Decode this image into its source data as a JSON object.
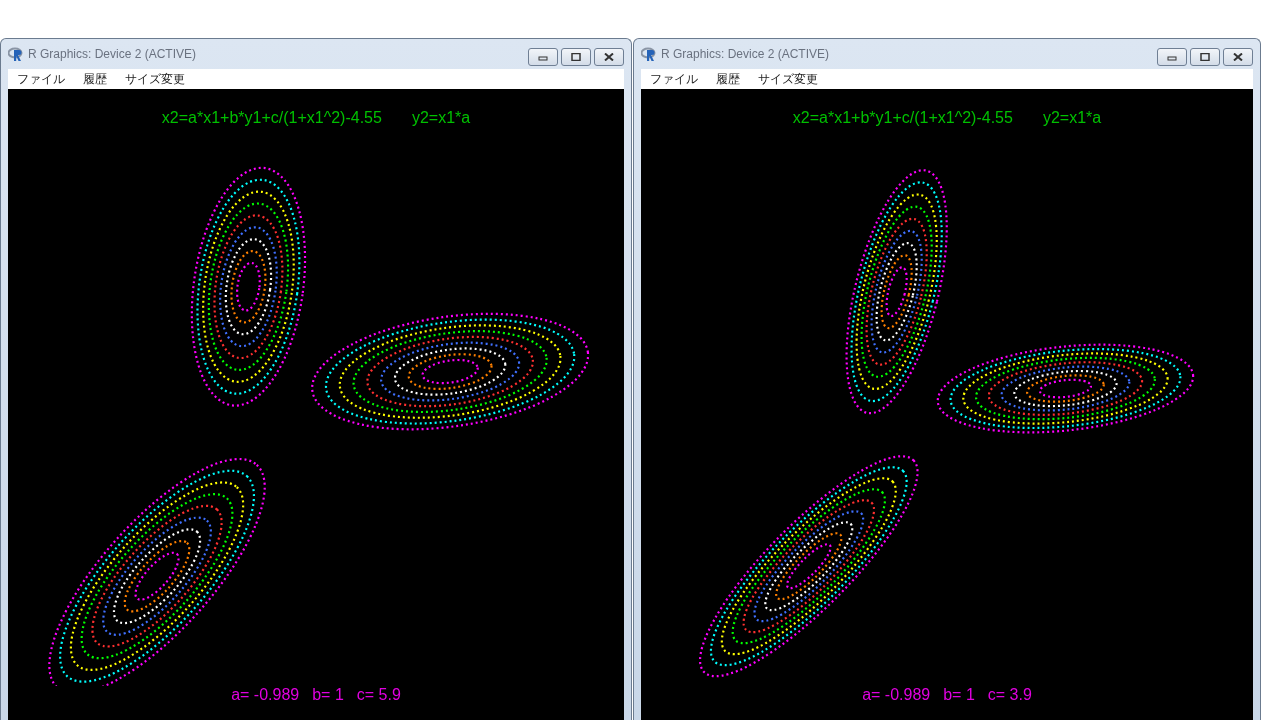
{
  "windows": [
    {
      "title": "R Graphics: Device 2 (ACTIVE)",
      "menu": [
        "ファイル",
        "履歴",
        "サイズ変更"
      ],
      "plot": {
        "equations": [
          "x2=a*x1+b*y1+c/(1+x1^2)-4.55",
          "y2=x1*a"
        ],
        "parameters": [
          "a= -0.989",
          "b= 1",
          "c= 5.9"
        ]
      }
    },
    {
      "title": "R Graphics: Device 2 (ACTIVE)",
      "menu": [
        "ファイル",
        "履歴",
        "サイズ変更"
      ],
      "plot": {
        "equations": [
          "x2=a*x1+b*y1+c/(1+x1^2)-4.55",
          "y2=x1*a"
        ],
        "parameters": [
          "a= -0.989",
          "b= 1",
          "c= 3.9"
        ]
      }
    }
  ]
}
